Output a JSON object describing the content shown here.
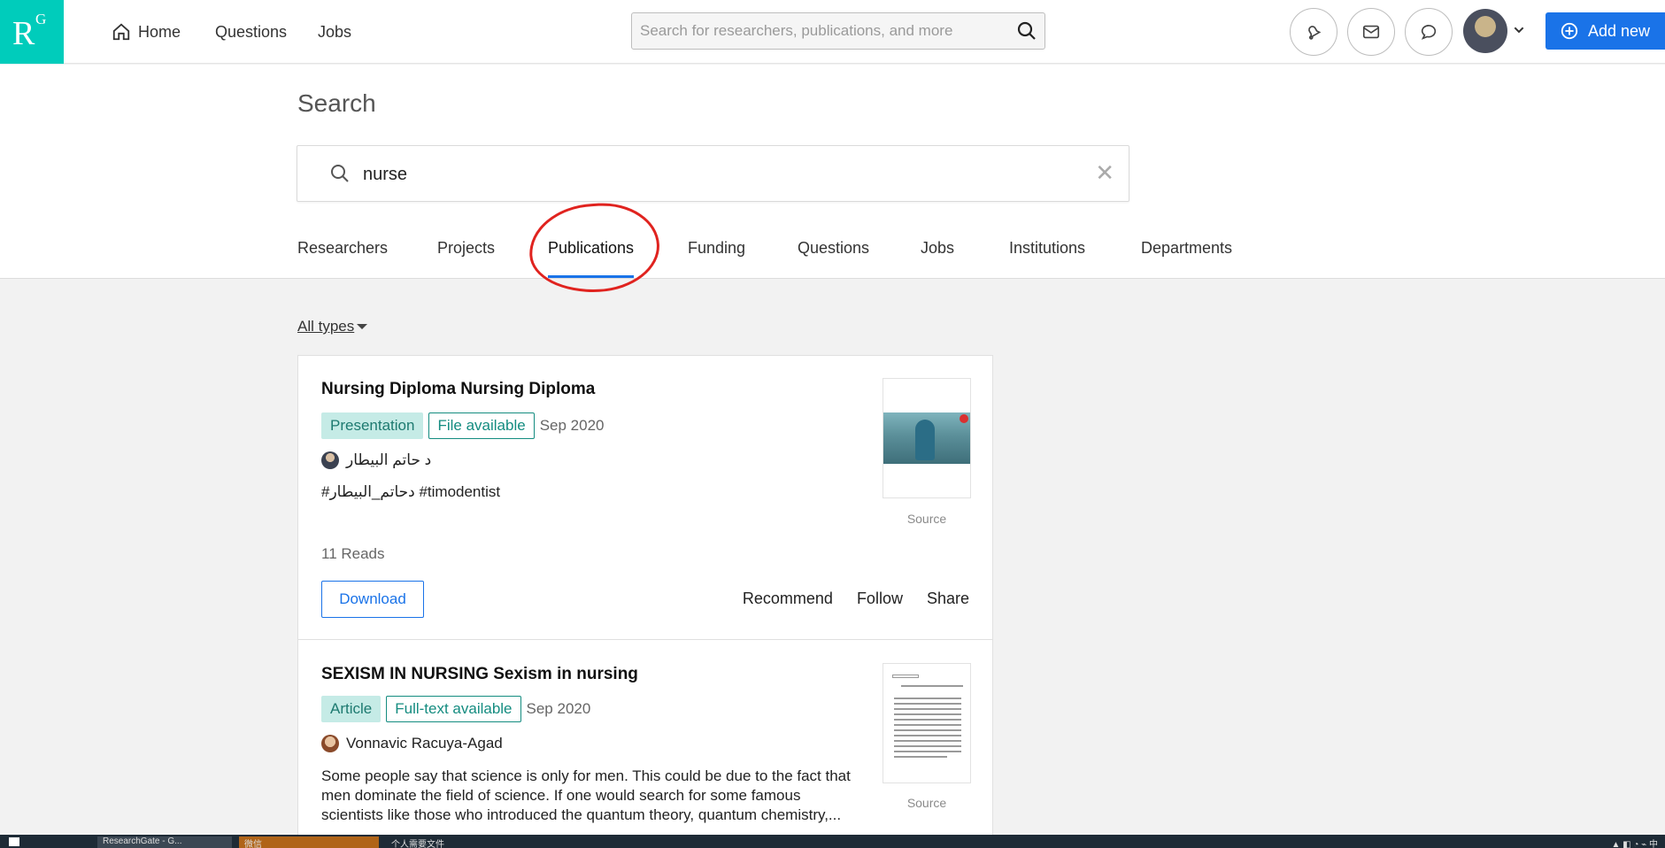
{
  "app": {
    "logo_main": "R",
    "logo_sup": "G"
  },
  "nav": {
    "home": "Home",
    "questions": "Questions",
    "jobs": "Jobs",
    "search_placeholder": "Search for researchers, publications, and more",
    "add_new": "Add new"
  },
  "search": {
    "title": "Search",
    "query": "nurse",
    "clear": "✕"
  },
  "tabs": [
    {
      "label": "Researchers"
    },
    {
      "label": "Projects"
    },
    {
      "label": "Publications",
      "active": true
    },
    {
      "label": "Funding"
    },
    {
      "label": "Questions"
    },
    {
      "label": "Jobs"
    },
    {
      "label": "Institutions"
    },
    {
      "label": "Departments"
    }
  ],
  "filter": {
    "all_types": "All types"
  },
  "results": [
    {
      "title": "Nursing Diploma Nursing Diploma",
      "type": "Presentation",
      "availability": "File available",
      "date": "Sep 2020",
      "author": "د حاتم البيطار",
      "description": "#دحاتم_البيطار #timodentist",
      "reads": "11 Reads",
      "download": "Download",
      "actions": [
        "Recommend",
        "Follow",
        "Share"
      ],
      "source": "Source"
    },
    {
      "title": "SEXISM IN NURSING Sexism in nursing",
      "type": "Article",
      "availability": "Full-text available",
      "date": "Sep 2020",
      "author": "Vonnavic Racuya-Agad",
      "description_lines": [
        "Some people say that science is only for men. This could be due to the fact that",
        "men dominate the field of science. If one would search for some famous",
        "scientists like those who introduced the quantum theory, quantum chemistry,..."
      ],
      "source": "Source"
    }
  ],
  "taskbar": {
    "chrome_label": "ResearchGate - G...",
    "wechat_label": "微信",
    "folder_label": "个人需要文件"
  },
  "colors": {
    "brand": "#00ccbb",
    "primary": "#1a73e8",
    "annotation": "#e0231f"
  }
}
